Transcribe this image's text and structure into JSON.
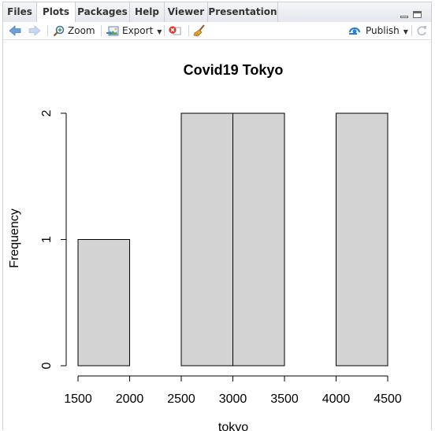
{
  "tabs": [
    {
      "label": "Files",
      "active": false
    },
    {
      "label": "Plots",
      "active": true
    },
    {
      "label": "Packages",
      "active": false
    },
    {
      "label": "Help",
      "active": false
    },
    {
      "label": "Viewer",
      "active": false
    },
    {
      "label": "Presentation",
      "active": false
    }
  ],
  "toolbar": {
    "back_icon": "arrow-left-icon",
    "forward_icon": "arrow-right-icon",
    "zoom_label": "Zoom",
    "export_label": "Export",
    "remove_icon": "remove-plot-icon",
    "clear_icon": "broom-icon",
    "publish_label": "Publish",
    "refresh_icon": "refresh-icon"
  },
  "colors": {
    "bar_fill": "#d3d3d3",
    "publish_accent": "#2a7fd4",
    "remove_red": "#d9352b"
  },
  "chart_data": {
    "type": "bar",
    "title": "Covid19 Tokyo",
    "xlabel": "tokyo",
    "ylabel": "Frequency",
    "bins": [
      {
        "start": 1500,
        "end": 2000,
        "count": 1
      },
      {
        "start": 2000,
        "end": 2500,
        "count": 0
      },
      {
        "start": 2500,
        "end": 3000,
        "count": 2
      },
      {
        "start": 3000,
        "end": 3500,
        "count": 2
      },
      {
        "start": 3500,
        "end": 4000,
        "count": 0
      },
      {
        "start": 4000,
        "end": 4500,
        "count": 2
      }
    ],
    "xticks": [
      "1500",
      "2000",
      "2500",
      "3000",
      "3500",
      "4000",
      "4500"
    ],
    "yticks": [
      "0",
      "1",
      "2"
    ],
    "xlim": [
      1500,
      4500
    ],
    "ylim": [
      0,
      2
    ],
    "grid": false
  }
}
